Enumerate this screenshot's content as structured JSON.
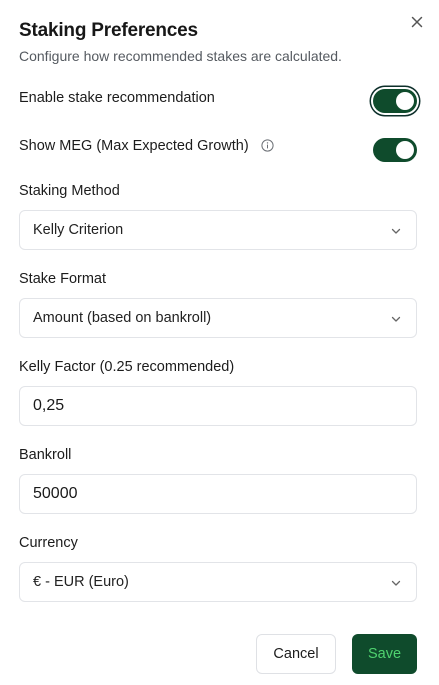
{
  "dialog": {
    "title": "Staking Preferences",
    "subtitle": "Configure how recommended stakes are calculated.",
    "close_icon": "close-icon"
  },
  "toggles": {
    "enable_stake": {
      "label": "Enable stake recommendation",
      "on": true
    },
    "show_meg": {
      "label": "Show MEG (Max Expected Growth)",
      "on": true,
      "info_icon": "info-icon"
    }
  },
  "fields": {
    "staking_method": {
      "label": "Staking Method",
      "value": "Kelly Criterion"
    },
    "stake_format": {
      "label": "Stake Format",
      "value": "Amount (based on bankroll)"
    },
    "kelly_factor": {
      "label": "Kelly Factor (0.25 recommended)",
      "value": "0,25"
    },
    "bankroll": {
      "label": "Bankroll",
      "value": "50000"
    },
    "currency": {
      "label": "Currency",
      "value": "€ - EUR (Euro)"
    }
  },
  "buttons": {
    "cancel": "Cancel",
    "save": "Save"
  },
  "colors": {
    "accent": "#0f4b2c",
    "save_text": "#4fd26f",
    "border": "#e2e4e8"
  }
}
